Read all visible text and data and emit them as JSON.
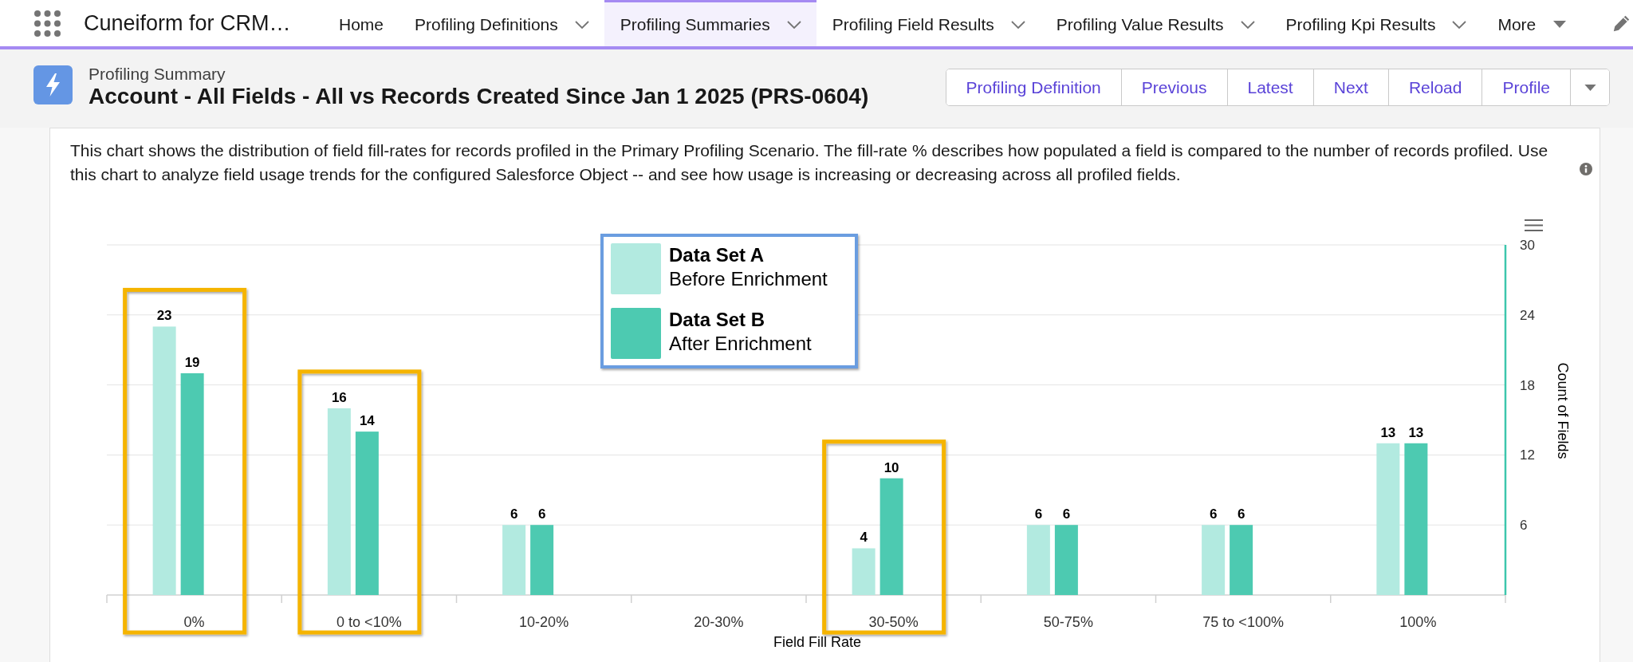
{
  "app_name": "Cuneiform for CRM…",
  "nav_tabs": [
    {
      "label": "Home",
      "has_menu": false,
      "selected": false
    },
    {
      "label": "Profiling Definitions",
      "has_menu": true,
      "selected": false
    },
    {
      "label": "Profiling Summaries",
      "has_menu": true,
      "selected": true
    },
    {
      "label": "Profiling Field Results",
      "has_menu": true,
      "selected": false
    },
    {
      "label": "Profiling Value Results",
      "has_menu": true,
      "selected": false
    },
    {
      "label": "Profiling Kpi Results",
      "has_menu": true,
      "selected": false
    }
  ],
  "more_tab": {
    "label": "More"
  },
  "record": {
    "object_label": "Profiling Summary",
    "title": "Account - All Fields - All vs Records Created Since Jan 1 2025 (PRS-0604)",
    "actions": [
      "Profiling Definition",
      "Previous",
      "Latest",
      "Next",
      "Reload",
      "Profile"
    ]
  },
  "description": "This chart shows the distribution of field fill-rates for records profiled in the Primary Profiling Scenario. The fill-rate % describes how populated a field is compared to the number of records profiled. Use this chart to analyze field usage trends for the configured Salesforce Object -- and see how usage is increasing or decreasing across all profiled fields.",
  "chart": {
    "legend_notes": [
      "Before Enrichment",
      "After Enrichment"
    ],
    "highlighted_categories": [
      true,
      true,
      false,
      false,
      true,
      false,
      false,
      false
    ],
    "chart_data": {
      "type": "bar",
      "xlabel": "Field Fill Rate",
      "ylabel": "Count of Fields",
      "categories": [
        "0%",
        "0 to <10%",
        "10-20%",
        "20-30%",
        "30-50%",
        "50-75%",
        "75 to <100%",
        "100%"
      ],
      "series": [
        {
          "name": "Data Set A",
          "color": "#b2eae0",
          "values": [
            23,
            16,
            6,
            null,
            4,
            6,
            6,
            13
          ]
        },
        {
          "name": "Data Set B",
          "color": "#4dcab1",
          "values": [
            19,
            14,
            6,
            null,
            10,
            6,
            6,
            13
          ]
        }
      ],
      "ylim": [
        0,
        30
      ],
      "yticks": [
        6,
        12,
        18,
        24,
        30
      ],
      "grid": true,
      "data_labels": true
    }
  }
}
